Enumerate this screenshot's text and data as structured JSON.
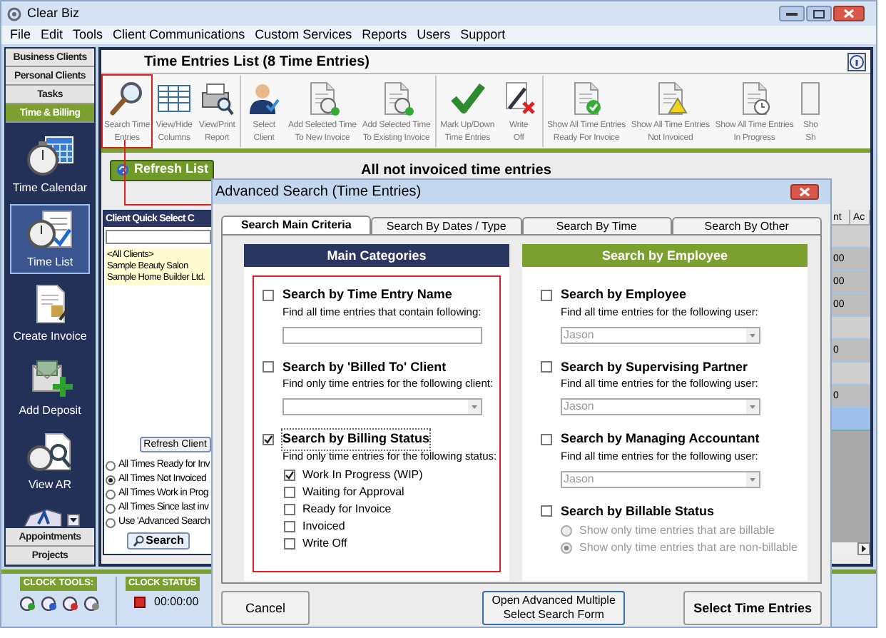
{
  "window": {
    "title": "Clear Biz"
  },
  "menu": [
    "File",
    "Edit",
    "Tools",
    "Client Communications",
    "Custom Services",
    "Reports",
    "Users",
    "Support"
  ],
  "sidebar": {
    "top_tabs": [
      {
        "label": "Business Clients",
        "selected": false
      },
      {
        "label": "Personal Clients",
        "selected": false
      },
      {
        "label": "Tasks",
        "selected": false
      },
      {
        "label": "Time & Billing",
        "selected": true
      }
    ],
    "items": [
      {
        "label": "Time Calendar",
        "selected": false
      },
      {
        "label": "Time List",
        "selected": true
      },
      {
        "label": "Create Invoice",
        "selected": false
      },
      {
        "label": "Add Deposit",
        "selected": false
      },
      {
        "label": "View AR",
        "selected": false
      }
    ],
    "bottom_tabs": [
      {
        "label": "Appointments",
        "selected": false
      },
      {
        "label": "Projects",
        "selected": false
      }
    ]
  },
  "content": {
    "title": "Time Entries List (8 Time Entries)",
    "toolbar": [
      {
        "lines": [
          "Search Time",
          "Entries"
        ],
        "highlighted": true,
        "group_start": false
      },
      {
        "lines": [
          "View/Hide",
          "Columns"
        ],
        "highlighted": false,
        "group_start": false
      },
      {
        "lines": [
          "View/Print",
          "Report"
        ],
        "highlighted": false,
        "group_start": false
      },
      {
        "lines": [
          "Select",
          "Client"
        ],
        "highlighted": false,
        "group_start": true
      },
      {
        "lines": [
          "Add Selected Time",
          "To New Invoice"
        ],
        "highlighted": false,
        "group_start": false
      },
      {
        "lines": [
          "Add Selected Time",
          "To Existing Invoice"
        ],
        "highlighted": false,
        "group_start": false
      },
      {
        "lines": [
          "Mark Up/Down",
          "Time Entries"
        ],
        "highlighted": false,
        "group_start": true
      },
      {
        "lines": [
          "Write",
          "Off"
        ],
        "highlighted": false,
        "group_start": false
      },
      {
        "lines": [
          "Show All Time Entries",
          "Ready For Invoice"
        ],
        "highlighted": false,
        "group_start": true
      },
      {
        "lines": [
          "Show All Time Entries",
          "Not Invoiced"
        ],
        "highlighted": false,
        "group_start": false
      },
      {
        "lines": [
          "Show All Time Entries",
          "In Progress"
        ],
        "highlighted": false,
        "group_start": false
      },
      {
        "lines": [
          "Sho",
          "Sh"
        ],
        "highlighted": false,
        "group_start": false
      }
    ],
    "refresh_button": "Refresh List",
    "filter_caption": "All not invoiced time entries",
    "quick_select": {
      "title": "Client Quick Select C",
      "clients": [
        "<All Clients>",
        "Sample Beauty Salon",
        "Sample Home Builder Ltd."
      ],
      "refresh_button": "Refresh Client",
      "filters": [
        {
          "label": "All Times Ready for Inv",
          "selected": false
        },
        {
          "label": "All Times Not Invoiced",
          "selected": true
        },
        {
          "label": "All Times Work in Prog",
          "selected": false
        },
        {
          "label": "All Times Since last inv",
          "selected": false
        },
        {
          "label": "Use 'Advanced Search",
          "selected": false
        }
      ],
      "search_button": "Search"
    },
    "grid": {
      "columns": [
        "nt",
        "Ac"
      ],
      "rows": [
        {
          "kind": "group"
        },
        {
          "kind": "entry",
          "column_1": "00"
        },
        {
          "kind": "entry",
          "column_1": "00"
        },
        {
          "kind": "entry",
          "column_1": "00"
        },
        {
          "kind": "group"
        },
        {
          "kind": "entry",
          "column_1": "0"
        },
        {
          "kind": "group"
        },
        {
          "kind": "entry",
          "column_1": "0"
        },
        {
          "kind": "selected"
        }
      ]
    }
  },
  "clock": {
    "tools_label": "CLOCK TOOLS:",
    "status_label": "CLOCK STATUS",
    "time": "00:00:00"
  },
  "dialog": {
    "title": "Advanced Search (Time Entries)",
    "tabs": [
      {
        "label": "Search Main Criteria",
        "selected": true
      },
      {
        "label": "Search By Dates / Type",
        "selected": false
      },
      {
        "label": "Search By Time",
        "selected": false
      },
      {
        "label": "Search By Other",
        "selected": false
      }
    ],
    "main_categories": {
      "title": "Main Categories",
      "highlighted": true,
      "criteria": [
        {
          "kind": "text",
          "label": "Search by Time Entry Name",
          "checked": false,
          "hint": "Find all time entries that contain following:"
        },
        {
          "kind": "dropdown",
          "label": "Search by 'Billed To' Client",
          "checked": false,
          "hint": "Find only time entries for the following client:"
        },
        {
          "kind": "checklist",
          "label": "Search by Billing Status",
          "checked": true,
          "hint": "Find only time entries for the following status:",
          "options": [
            {
              "label": "Work In Progress (WIP)",
              "checked": true
            },
            {
              "label": "Waiting for Approval",
              "checked": false
            },
            {
              "label": "Ready for Invoice",
              "checked": false
            },
            {
              "label": "Invoiced",
              "checked": false
            },
            {
              "label": "Write Off",
              "checked": false
            }
          ]
        }
      ]
    },
    "employee": {
      "title": "Search by Employee",
      "criteria": [
        {
          "kind": "dropdown",
          "label": "Search by Employee",
          "checked": false,
          "hint": "Find all time entries for the following user:",
          "value": "Jason",
          "disabled": true
        },
        {
          "kind": "dropdown",
          "label": "Search by Supervising Partner",
          "checked": false,
          "hint": "Find all time entries for the following user:",
          "value": "Jason",
          "disabled": true
        },
        {
          "kind": "dropdown",
          "label": "Search by Managing Accountant",
          "checked": false,
          "hint": "Find all time entries for the following user:",
          "value": "Jason",
          "disabled": true
        },
        {
          "kind": "radios",
          "label": "Search by Billable Status",
          "checked": false,
          "disabled": true,
          "options": [
            {
              "label": "Show only time entries that are billable",
              "selected": false
            },
            {
              "label": "Show only time entries that are non-billable",
              "selected": true
            }
          ]
        }
      ]
    },
    "buttons": [
      {
        "lines": [
          "Cancel"
        ]
      },
      {
        "lines": [
          "Open Advanced Multiple",
          "Select Search Form"
        ]
      },
      {
        "lines": [
          "Select Time Entries"
        ]
      }
    ]
  }
}
